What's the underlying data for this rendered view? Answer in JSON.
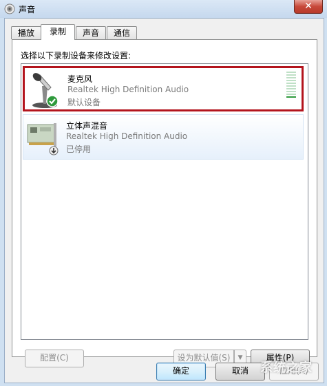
{
  "window": {
    "title": "声音",
    "close_glyph": "✕"
  },
  "tabs": [
    {
      "label": "播放",
      "active": false
    },
    {
      "label": "录制",
      "active": true
    },
    {
      "label": "声音",
      "active": false
    },
    {
      "label": "通信",
      "active": false
    }
  ],
  "instruction": "选择以下录制设备来修改设置:",
  "devices": [
    {
      "name": "麦克风",
      "driver": "Realtek High Definition Audio",
      "status": "默认设备",
      "icon": "microphone-icon",
      "badge": "check-badge-icon",
      "selected": true
    },
    {
      "name": "立体声混音",
      "driver": "Realtek High Definition Audio",
      "status": "已停用",
      "icon": "sound-card-icon",
      "badge": "disabled-badge-icon",
      "selected": false
    }
  ],
  "level_meter": {
    "segments": 10,
    "active": 1
  },
  "buttons": {
    "configure": "配置(C)",
    "set_default": "设为默认值(S)",
    "properties": "属性(P)",
    "ok": "确定",
    "cancel": "取消",
    "apply": "应用(A)"
  },
  "watermark": "系统之家",
  "colors": {
    "selection_border": "#b3141d",
    "check_green": "#2f9a3c"
  }
}
